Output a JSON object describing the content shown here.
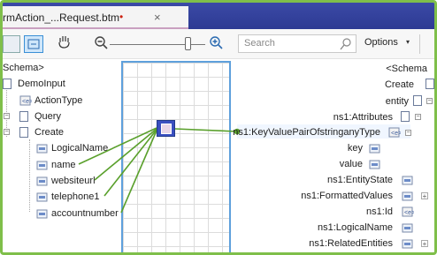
{
  "tab": {
    "title": "rmAction_...Request.btm",
    "modified": "•",
    "close": "×"
  },
  "toolbar": {
    "search_placeholder": "Search",
    "options_label": "Options",
    "options_arrow": "▾"
  },
  "source": {
    "root": "Schema>",
    "items": [
      "DemoInput",
      "ActionType",
      "Query",
      "Create",
      "LogicalName",
      "name",
      "websiteurl",
      "telephone1",
      "accountnumber"
    ]
  },
  "destination": {
    "items": [
      "<Schema",
      "Create",
      "entity",
      "ns1:Attributes",
      "ns1:KeyValuePairOfstringanyType",
      "key",
      "value",
      "ns1:EntityState",
      "ns1:FormattedValues",
      "ns1:Id",
      "ns1:LogicalName",
      "ns1:RelatedEntities"
    ]
  },
  "colors": {
    "link": "#5aa02c",
    "tab_bar": "#2d3a93",
    "grid_border": "#5ea0dc"
  }
}
